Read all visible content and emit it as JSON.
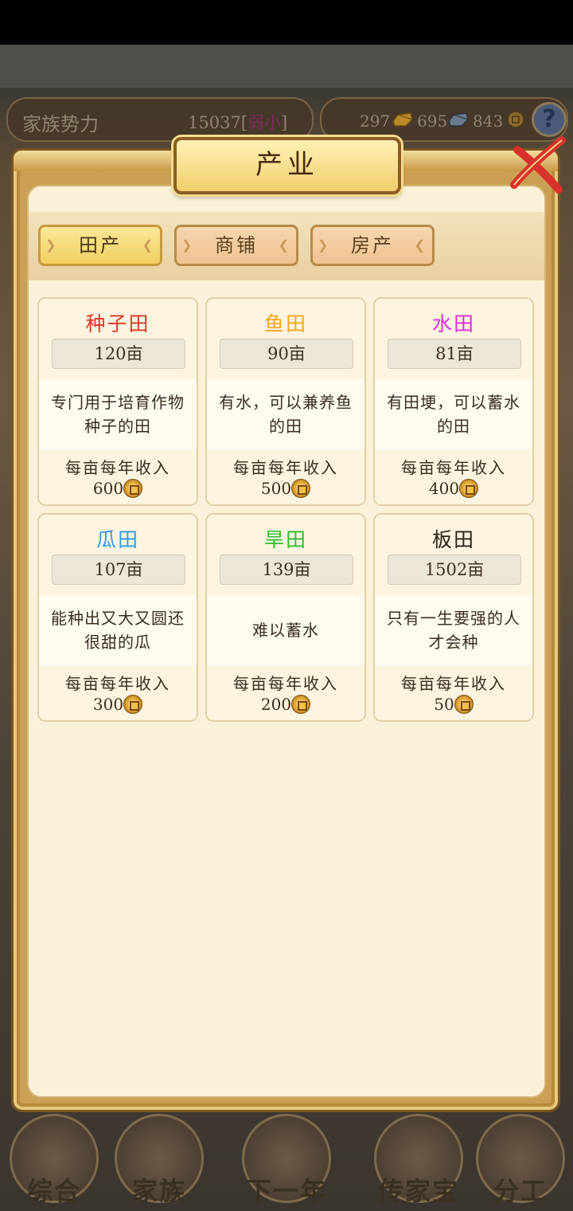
{
  "top_bar": {
    "family_label": "家族势力",
    "family_value": "15037[",
    "family_rank": "弱小",
    "family_close": "]",
    "gold": "297",
    "silver": "695",
    "coins": "843",
    "help": "?"
  },
  "dialog": {
    "title": "产业",
    "tabs": [
      {
        "label": "田产",
        "active": true
      },
      {
        "label": "商铺",
        "active": false
      },
      {
        "label": "房产",
        "active": false
      }
    ],
    "income_label": "每亩每年收入",
    "fields": [
      {
        "name": "种子田",
        "color": "#e03a2a",
        "size": "120亩",
        "desc": "专门用于培育作物种子的田",
        "income": "600"
      },
      {
        "name": "鱼田",
        "color": "#f2a622",
        "size": "90亩",
        "desc": "有水，可以兼养鱼的田",
        "income": "500"
      },
      {
        "name": "水田",
        "color": "#e02ee0",
        "size": "81亩",
        "desc": "有田埂，可以蓄水的田",
        "income": "400"
      },
      {
        "name": "瓜田",
        "color": "#2e9ee2",
        "size": "107亩",
        "desc": "能种出又大又圆还很甜的瓜",
        "income": "300"
      },
      {
        "name": "旱田",
        "color": "#2ec02e",
        "size": "139亩",
        "desc": "难以蓄水",
        "income": "200"
      },
      {
        "name": "板田",
        "color": "#2a2418",
        "size": "1502亩",
        "desc": "只有一生要强的人才会种",
        "income": "50"
      }
    ]
  },
  "bottom_nav": [
    {
      "label": "综合"
    },
    {
      "label": "家族"
    },
    {
      "label": "下一年"
    },
    {
      "label": "传家宝"
    },
    {
      "label": "分工"
    }
  ]
}
